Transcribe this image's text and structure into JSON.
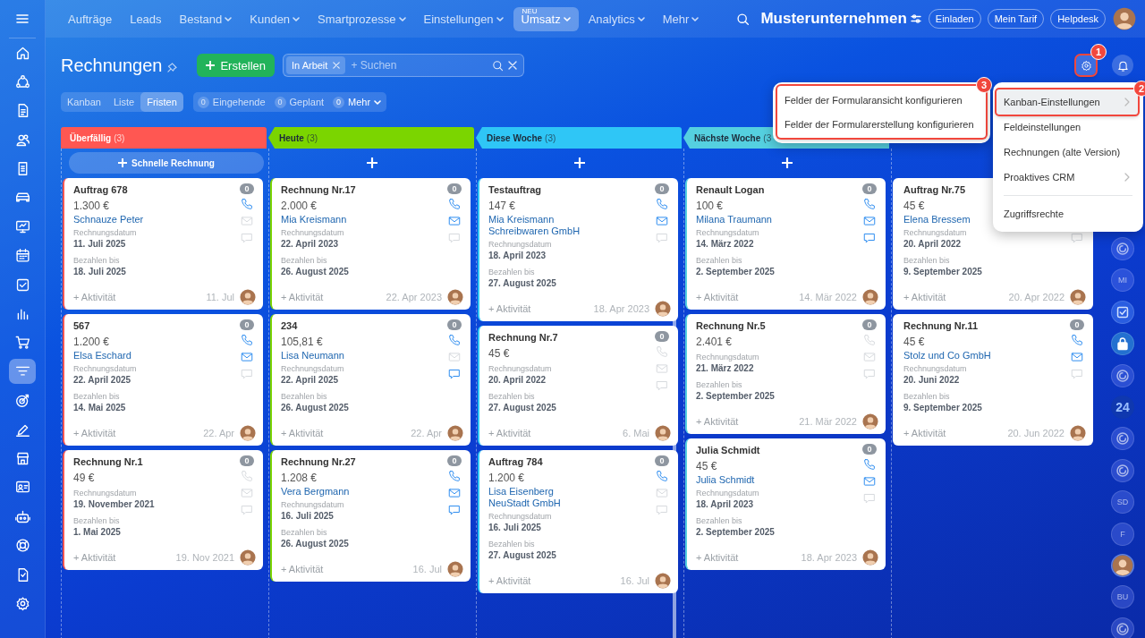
{
  "topbar": {
    "nav": [
      {
        "label": "Aufträge",
        "dropdown": false,
        "selected": false
      },
      {
        "label": "Leads",
        "dropdown": false,
        "selected": false
      },
      {
        "label": "Bestand",
        "dropdown": true,
        "selected": false
      },
      {
        "label": "Kunden",
        "dropdown": true,
        "selected": false
      },
      {
        "label": "Smartprozesse",
        "dropdown": true,
        "selected": false
      },
      {
        "label": "Einstellungen",
        "dropdown": true,
        "selected": false
      },
      {
        "label": "Umsatz",
        "dropdown": true,
        "selected": true,
        "tag": "NEU"
      },
      {
        "label": "Analytics",
        "dropdown": true,
        "selected": false
      },
      {
        "label": "Mehr",
        "dropdown": true,
        "selected": false
      }
    ],
    "company": "Musterunternehmen",
    "buttons": [
      "Einladen",
      "Mein Tarif",
      "Helpdesk"
    ]
  },
  "sidebar": {
    "items": [
      {
        "selected": false
      },
      {
        "selected": false
      },
      {
        "selected": false
      },
      {
        "selected": false
      },
      {
        "selected": false
      },
      {
        "selected": false
      },
      {
        "selected": false
      },
      {
        "selected": false
      },
      {
        "selected": false
      },
      {
        "selected": false
      },
      {
        "selected": false
      },
      {
        "selected": true
      },
      {
        "selected": false
      },
      {
        "selected": false
      },
      {
        "selected": false
      },
      {
        "selected": false
      },
      {
        "selected": false
      },
      {
        "selected": false
      },
      {
        "selected": false
      },
      {
        "selected": false
      }
    ]
  },
  "page": {
    "title": "Rechnungen",
    "create_button": "Erstellen",
    "filter_chip": "In Arbeit",
    "search_placeholder": "+ Suchen"
  },
  "views": [
    {
      "label": "Kanban",
      "selected": false
    },
    {
      "label": "Liste",
      "selected": false
    },
    {
      "label": "Fristen",
      "selected": true
    }
  ],
  "counters": [
    {
      "count": "0",
      "label": "Eingehende",
      "dropdown": false
    },
    {
      "count": "0",
      "label": "Geplant",
      "dropdown": false
    },
    {
      "count": "0",
      "label": "Mehr",
      "dropdown": true
    }
  ],
  "settings_button": {
    "callout": "1"
  },
  "columns": [
    {
      "title": "Überfällig",
      "count": "(3)",
      "color": "#ff5752",
      "add_button": true,
      "add_label": "Schnelle Rechnung",
      "scrollbar": false,
      "cards": [
        {
          "title": "Auftrag 678",
          "badge": "0",
          "amount": "1.300 €",
          "contacts": [
            "Schnauze Peter"
          ],
          "date_label": "Rechnungsdatum",
          "date": "11. Juli 2025",
          "due_label": "Bezahlen bis",
          "due": "18. Juli 2025",
          "activity": "+ Aktivität",
          "footer_date": "11. Jul",
          "phone": true,
          "mail": false,
          "chat": false
        },
        {
          "title": "567",
          "badge": "0",
          "amount": "1.200 €",
          "contacts": [
            "Elsa Eschard"
          ],
          "date_label": "Rechnungsdatum",
          "date": "22. April 2025",
          "due_label": "Bezahlen bis",
          "due": "14. Mai 2025",
          "activity": "+ Aktivität",
          "footer_date": "22. Apr",
          "phone": true,
          "mail": true,
          "chat": false
        },
        {
          "title": "Rechnung Nr.1",
          "badge": "0",
          "amount": "49 €",
          "date_label": "Rechnungsdatum",
          "date": "19. November 2021",
          "due_label": "Bezahlen bis",
          "due": "1. Mai 2025",
          "activity": "+ Aktivität",
          "footer_date": "19. Nov 2021",
          "phone": false,
          "mail": false,
          "chat": false
        }
      ]
    },
    {
      "title": "Heute",
      "count": "(3)",
      "color": "#7bd500",
      "add_button": true,
      "scrollbar": false,
      "cards": [
        {
          "title": "Rechnung Nr.17",
          "badge": "0",
          "amount": "2.000 €",
          "contacts": [
            "Mia Kreismann"
          ],
          "date_label": "Rechnungsdatum",
          "date": "22. April 2023",
          "due_label": "Bezahlen bis",
          "due": "26. August 2025",
          "activity": "+ Aktivität",
          "footer_date": "22. Apr 2023",
          "phone": true,
          "mail": true,
          "chat": false
        },
        {
          "title": "234",
          "badge": "0",
          "amount": "105,81 €",
          "contacts": [
            "Lisa Neumann"
          ],
          "date_label": "Rechnungsdatum",
          "date": "22. April 2025",
          "due_label": "Bezahlen bis",
          "due": "26. August 2025",
          "activity": "+ Aktivität",
          "footer_date": "22. Apr",
          "phone": true,
          "mail": false,
          "chat": true
        },
        {
          "title": "Rechnung Nr.27",
          "badge": "0",
          "amount": "1.208 €",
          "contacts": [
            "Vera Bergmann"
          ],
          "date_label": "Rechnungsdatum",
          "date": "16. Juli 2025",
          "due_label": "Bezahlen bis",
          "due": "26. August 2025",
          "activity": "+ Aktivität",
          "footer_date": "16. Jul",
          "phone": true,
          "mail": true,
          "chat": true
        }
      ]
    },
    {
      "title": "Diese Woche",
      "count": "(3)",
      "color": "#2fc6f6",
      "add_button": true,
      "scrollbar": true,
      "cards": [
        {
          "title": "Testauftrag",
          "badge": "0",
          "amount": "147 €",
          "contacts": [
            "Mia Kreismann",
            "Schreibwaren GmbH"
          ],
          "date_label": "Rechnungsdatum",
          "date": "18. April 2023",
          "due_label": "Bezahlen bis",
          "due": "27. August 2025",
          "activity": "+ Aktivität",
          "footer_date": "18. Apr 2023",
          "phone": true,
          "mail": true,
          "chat": false
        },
        {
          "title": "Rechnung Nr.7",
          "badge": "0",
          "amount": "45 €",
          "date_label": "Rechnungsdatum",
          "date": "20. April 2022",
          "due_label": "Bezahlen bis",
          "due": "27. August 2025",
          "activity": "+ Aktivität",
          "footer_date": "6. Mai",
          "phone": false,
          "mail": false,
          "chat": false
        },
        {
          "title": "Auftrag 784",
          "badge": "0",
          "amount": "1.200 €",
          "contacts": [
            "Lisa Eisenberg",
            "NeuStadt GmbH"
          ],
          "date_label": "Rechnungsdatum",
          "date": "16. Juli 2025",
          "due_label": "Bezahlen bis",
          "due": "27. August 2025",
          "activity": "+ Aktivität",
          "footer_date": "16. Jul",
          "phone": true,
          "mail": false,
          "chat": false
        }
      ]
    },
    {
      "title": "Nächste Woche",
      "count": "(3",
      "color": "#55d0e0",
      "add_button": true,
      "scrollbar": false,
      "cards": [
        {
          "title": "Renault Logan",
          "badge": "0",
          "amount": "100 €",
          "contacts": [
            "Milana Traumann"
          ],
          "date_label": "Rechnungsdatum",
          "date": "14. März 2022",
          "due_label": "Bezahlen bis",
          "due": "2. September 2025",
          "activity": "+ Aktivität",
          "footer_date": "14. Mär 2022",
          "phone": true,
          "mail": true,
          "chat": true
        },
        {
          "title": "Rechnung Nr.5",
          "badge": "0",
          "amount": "2.401 €",
          "date_label": "Rechnungsdatum",
          "date": "21. März 2022",
          "due_label": "Bezahlen bis",
          "due": "2. September 2025",
          "activity": "+ Aktivität",
          "footer_date": "21. Mär 2022",
          "phone": false,
          "mail": false,
          "chat": false
        },
        {
          "title": "Julia Schmidt",
          "badge": "0",
          "amount": "45 €",
          "contacts": [
            "Julia Schmidt"
          ],
          "date_label": "Rechnungsdatum",
          "date": "18. April 2023",
          "due_label": "Bezahlen bis",
          "due": "2. September 2025",
          "activity": "+ Aktivität",
          "footer_date": "18. Apr 2023",
          "phone": true,
          "mail": true,
          "chat": false
        }
      ]
    },
    {
      "add_button": false,
      "scrollbar": false,
      "cards": [
        {
          "title": "Auftrag Nr.75",
          "amount": "45 €",
          "contacts": [
            "Elena Bressem"
          ],
          "date_label": "Rechnungsdatum",
          "date": "20. April 2022",
          "due_label": "Bezahlen bis",
          "due": "9. September 2025",
          "activity": "+ Aktivität",
          "footer_date": "20. Apr 2022",
          "chat": false
        },
        {
          "title": "Rechnung Nr.11",
          "badge": "0",
          "amount": "45 €",
          "contacts": [
            "Stolz und Co GmbH"
          ],
          "date_label": "Rechnungsdatum",
          "date": "20. Juni 2022",
          "due_label": "Bezahlen bis",
          "due": "9. September 2025",
          "activity": "+ Aktivität",
          "footer_date": "20. Jun 2022",
          "phone": true,
          "mail": true,
          "chat": false
        }
      ]
    }
  ],
  "settings_menu": {
    "items": [
      {
        "label": "Kanban-Einstellungen",
        "submenu": true,
        "selected": true,
        "divider_before": false,
        "callout": "2"
      },
      {
        "label": "Feldeinstellungen",
        "submenu": false,
        "selected": false,
        "divider_before": false
      },
      {
        "label": "Rechnungen (alte Version)",
        "submenu": false,
        "selected": false,
        "divider_before": false
      },
      {
        "label": "Proaktives CRM",
        "submenu": true,
        "selected": false,
        "divider_before": false
      },
      {
        "label": "Zugriffsrechte",
        "submenu": false,
        "selected": false,
        "divider_before": true
      }
    ],
    "submenu": {
      "callout": "3",
      "items": [
        "Felder der Formularansicht konfigurieren",
        "Felder der Formularerstellung konfigurieren"
      ]
    }
  },
  "right_rail": [
    {
      "kind": "swirl"
    },
    {
      "kind": "initials",
      "text": "MI"
    },
    {
      "kind": "check"
    },
    {
      "kind": "lock"
    },
    {
      "kind": "swirl"
    },
    {
      "kind": "logo",
      "text": "24"
    },
    {
      "kind": "swirl"
    },
    {
      "kind": "swirl"
    },
    {
      "kind": "initials",
      "text": "SD"
    },
    {
      "kind": "initials",
      "text": "F"
    },
    {
      "kind": "avatar"
    },
    {
      "kind": "initials",
      "text": "BU"
    },
    {
      "kind": "swirl"
    }
  ]
}
